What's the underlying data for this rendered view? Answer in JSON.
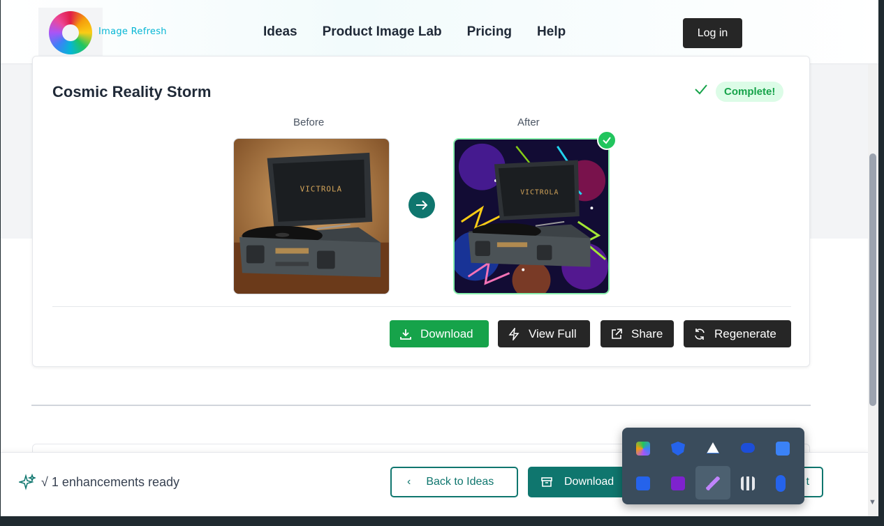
{
  "header": {
    "brand": "Image Refresh",
    "nav": [
      "Ideas",
      "Product Image Lab",
      "Pricing",
      "Help"
    ],
    "login_label": "Log in"
  },
  "card": {
    "title": "Cosmic Reality Storm",
    "status": "Complete!",
    "before_label": "Before",
    "after_label": "After",
    "product_text": "VICTROLA",
    "actions": {
      "download": "Download",
      "view_full": "View Full",
      "share": "Share",
      "regenerate": "Regenerate"
    }
  },
  "bottom_bar": {
    "ready_text": "√ 1 enhancements ready",
    "back_label": "Back to Ideas",
    "download_all_label": "Download",
    "next_label": "t"
  },
  "tray": {
    "icons": [
      "copilot-icon",
      "defender-icon",
      "google-drive-icon",
      "meta-icon",
      "todo-icon",
      "outlook-icon",
      "onenote-icon",
      "feather-icon",
      "slack-icon",
      "bluetooth-icon"
    ]
  },
  "colors": {
    "accent": "#0f766e",
    "success": "#16a34a",
    "dark_button": "#262626"
  }
}
